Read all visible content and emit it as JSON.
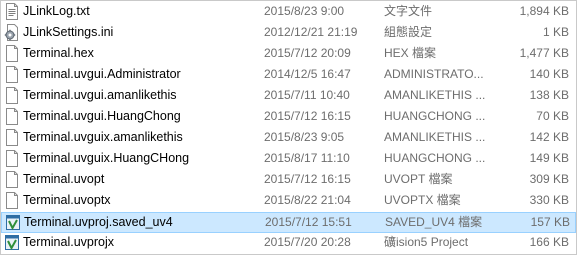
{
  "files": [
    {
      "name": "JLinkLog.txt",
      "modified": "2015/8/23 9:00",
      "type": "文字文件",
      "size": "1,894 KB",
      "icon": "text-file-icon"
    },
    {
      "name": "JLinkSettings.ini",
      "modified": "2012/12/21 21:19",
      "type": "組態設定",
      "size": "1 KB",
      "icon": "settings-file-icon"
    },
    {
      "name": "Terminal.hex",
      "modified": "2015/7/12 20:09",
      "type": "HEX 檔案",
      "size": "1,477 KB",
      "icon": "blank-file-icon"
    },
    {
      "name": "Terminal.uvgui.Administrator",
      "modified": "2014/12/5 16:47",
      "type": "ADMINISTRATO...",
      "size": "140 KB",
      "icon": "blank-file-icon"
    },
    {
      "name": "Terminal.uvgui.amanlikethis",
      "modified": "2015/7/11 10:40",
      "type": "AMANLIKETHIS ...",
      "size": "138 KB",
      "icon": "blank-file-icon"
    },
    {
      "name": "Terminal.uvgui.HuangChong",
      "modified": "2015/7/12 16:15",
      "type": "HUANGCHONG ...",
      "size": "70 KB",
      "icon": "blank-file-icon"
    },
    {
      "name": "Terminal.uvguix.amanlikethis",
      "modified": "2015/8/23 9:05",
      "type": "AMANLIKETHIS ...",
      "size": "142 KB",
      "icon": "blank-file-icon"
    },
    {
      "name": "Terminal.uvguix.HuangCHong",
      "modified": "2015/8/17 11:10",
      "type": "HUANGCHONG ...",
      "size": "149 KB",
      "icon": "blank-file-icon"
    },
    {
      "name": "Terminal.uvopt",
      "modified": "2015/7/12 16:15",
      "type": "UVOPT 檔案",
      "size": "309 KB",
      "icon": "blank-file-icon"
    },
    {
      "name": "Terminal.uvoptx",
      "modified": "2015/8/22 21:04",
      "type": "UVOPTX 檔案",
      "size": "330 KB",
      "icon": "blank-file-icon"
    },
    {
      "name": "Terminal.uvproj.saved_uv4",
      "modified": "2015/7/12 15:51",
      "type": "SAVED_UV4 檔案",
      "size": "157 KB",
      "icon": "keil-project-icon",
      "selected": true
    },
    {
      "name": "Terminal.uvprojx",
      "modified": "2015/7/20 20:28",
      "type": "礦ision5 Project",
      "size": "166 KB",
      "icon": "keil-project-icon"
    }
  ]
}
